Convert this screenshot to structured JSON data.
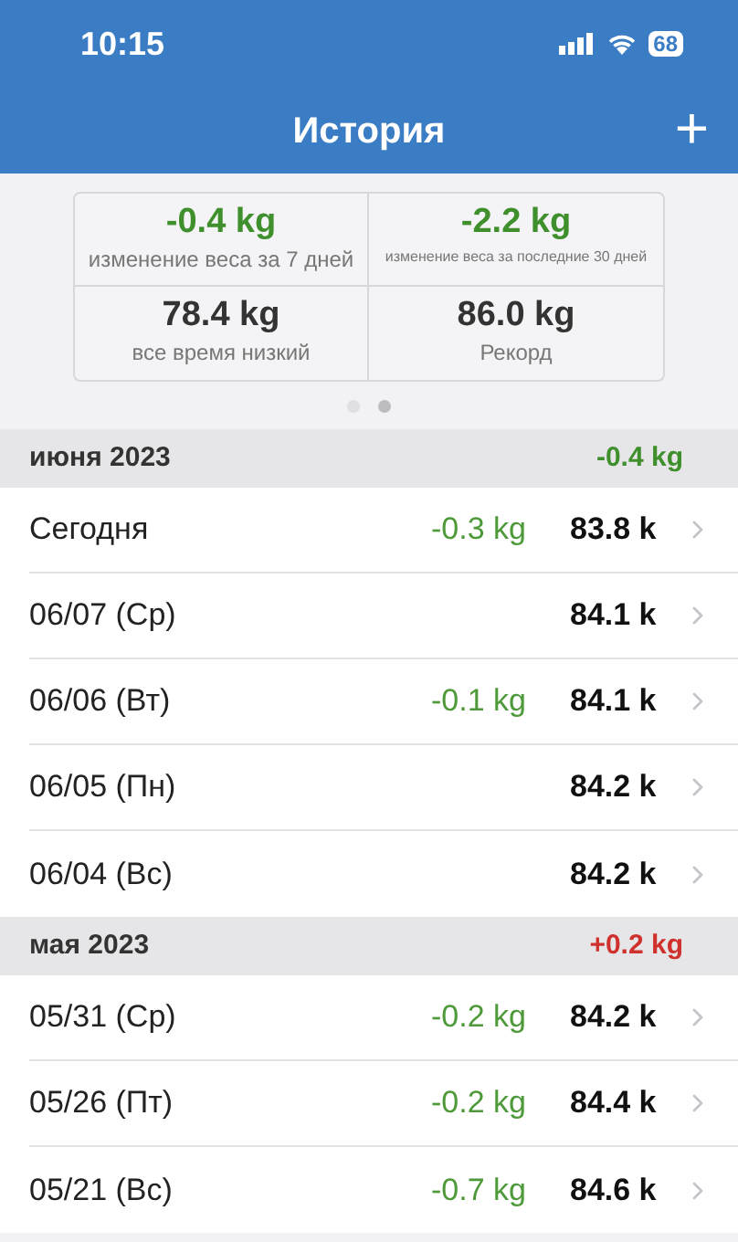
{
  "status_bar": {
    "time": "10:15",
    "battery": "68"
  },
  "nav": {
    "title": "История",
    "add": "+"
  },
  "summary": [
    {
      "value": "-0.4 kg",
      "label": "изменение веса за 7 дней",
      "color": "#3f8f2c",
      "kind": "regular"
    },
    {
      "value": "-2.2 kg",
      "label": "изменение веса за последние 30 дней",
      "color": "#3f8f2c",
      "kind": "compact"
    },
    {
      "value": "78.4 kg",
      "label": "все время низкий",
      "color": "#333333",
      "kind": "regular"
    },
    {
      "value": "86.0 kg",
      "label": "Рекорд",
      "color": "#333333",
      "kind": "regular"
    }
  ],
  "pager": [
    {
      "selected": false
    },
    {
      "selected": true
    }
  ],
  "sections": [
    {
      "title": "июня 2023",
      "change": "-0.4 kg",
      "color": "#3f8f2c",
      "rows": [
        {
          "date": "Сегодня",
          "change": "-0.3 kg",
          "weight": "83.8 k"
        },
        {
          "date": "06/07 (Ср)",
          "weight": "84.1 k"
        },
        {
          "date": "06/06 (Вт)",
          "change": "-0.1 kg",
          "weight": "84.1 k"
        },
        {
          "date": "06/05 (Пн)",
          "weight": "84.2 k"
        },
        {
          "date": "06/04 (Вс)",
          "weight": "84.2 k"
        }
      ]
    },
    {
      "title": "мая 2023",
      "change": "+0.2 kg",
      "color": "#d0312d",
      "rows": [
        {
          "date": "05/31 (Ср)",
          "change": "-0.2 kg",
          "weight": "84.2 k"
        },
        {
          "date": "05/26 (Пт)",
          "change": "-0.2 kg",
          "weight": "84.4 k"
        },
        {
          "date": "05/21 (Вс)",
          "change": "-0.7 kg",
          "weight": "84.6 k"
        }
      ]
    }
  ]
}
